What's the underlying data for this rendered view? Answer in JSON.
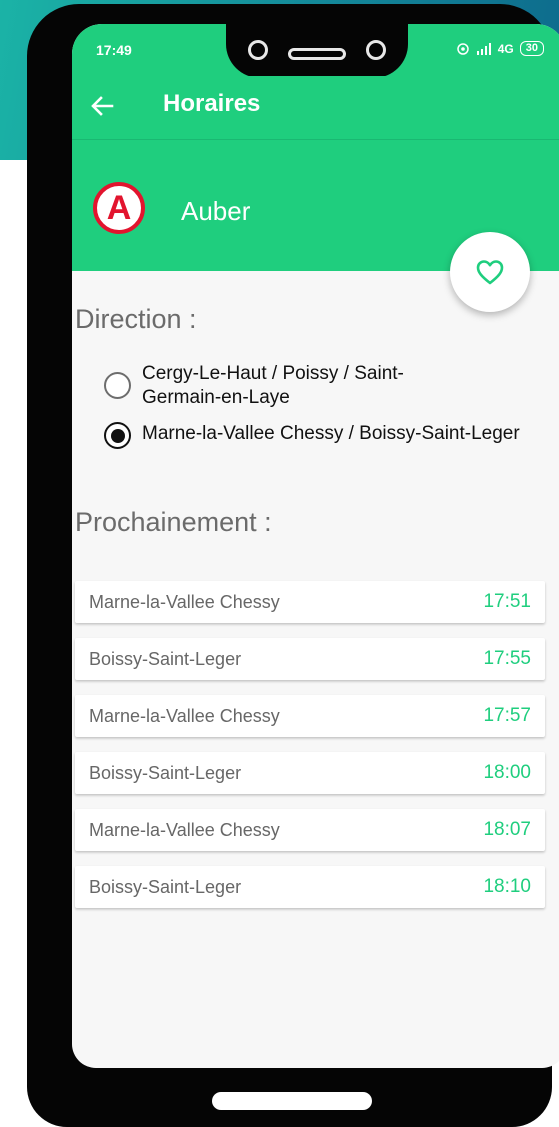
{
  "status": {
    "time": "17:49",
    "network": "4G",
    "battery": "30"
  },
  "appbar": {
    "title": "Horaires"
  },
  "station": {
    "line": "A",
    "name": "Auber",
    "line_color": "#e2142e"
  },
  "direction": {
    "label": "Direction :",
    "options": [
      {
        "label": "Cergy-Le-Haut / Poissy / Saint-Germain-en-Laye",
        "selected": false
      },
      {
        "label": "Marne-la-Vallee Chessy / Boissy-Saint-Leger",
        "selected": true
      }
    ]
  },
  "next": {
    "label": "Prochainement :",
    "departures": [
      {
        "destination": "Marne-la-Vallee Chessy",
        "time": "17:51"
      },
      {
        "destination": "Boissy-Saint-Leger",
        "time": "17:55"
      },
      {
        "destination": "Marne-la-Vallee Chessy",
        "time": "17:57"
      },
      {
        "destination": "Boissy-Saint-Leger",
        "time": "18:00"
      },
      {
        "destination": "Marne-la-Vallee Chessy",
        "time": "18:07"
      },
      {
        "destination": "Boissy-Saint-Leger",
        "time": "18:10"
      }
    ]
  },
  "colors": {
    "accent": "#1fce7e",
    "background": "#f7f7f7"
  }
}
